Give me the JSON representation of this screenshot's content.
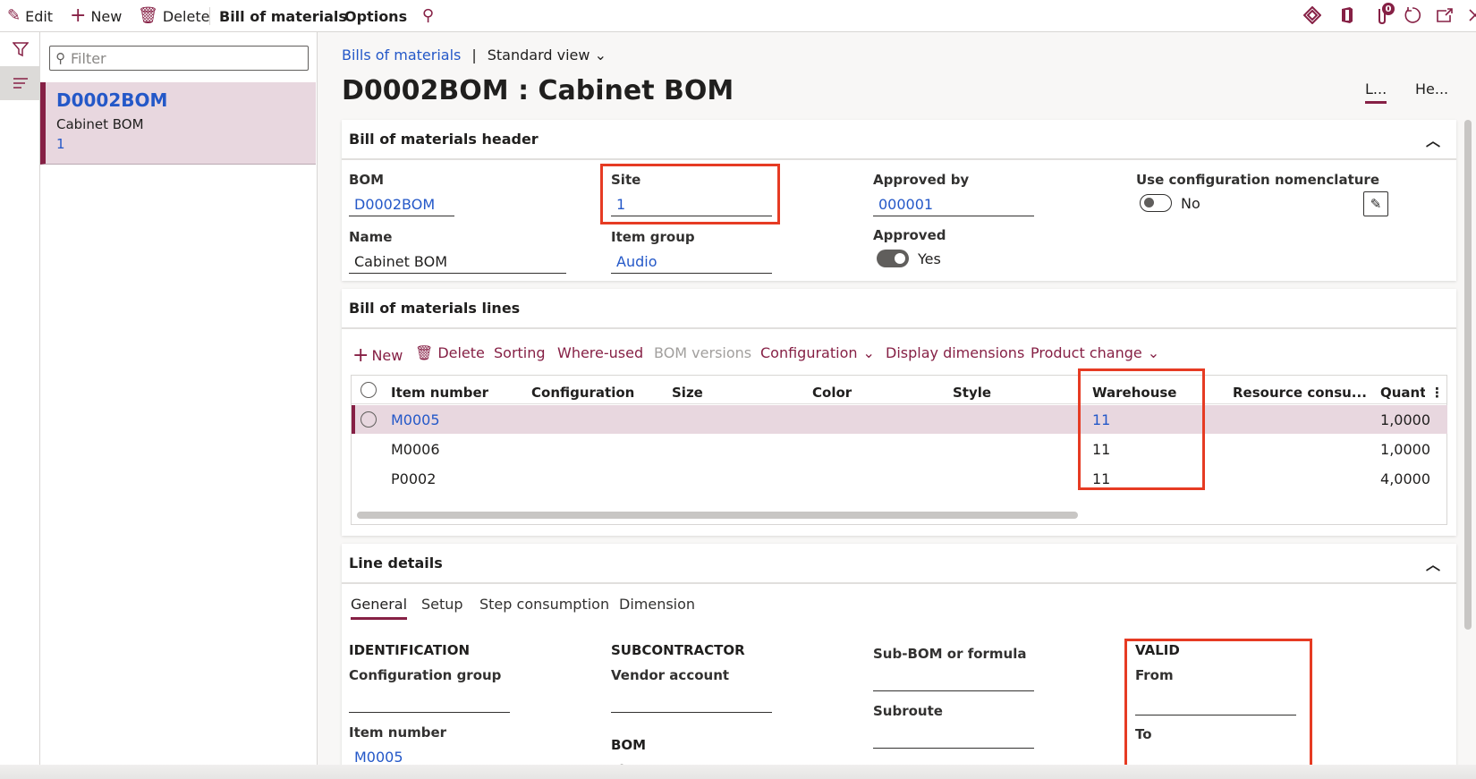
{
  "topbar": {
    "edit": "Edit",
    "new": "New",
    "delete": "Delete",
    "bill_of_materials": "Bill of materials",
    "options": "Options",
    "icons": [
      "search-icon",
      "diamond-grid-icon",
      "office-icon",
      "attachments-icon",
      "refresh-icon",
      "open-in-new-window-icon",
      "close-icon"
    ],
    "attachment_count": "0"
  },
  "colors": {
    "brand": "#862045",
    "link": "#2458c8",
    "highlight": "#e63b23",
    "selected_row": "#e8d7df"
  },
  "listpane": {
    "filter_placeholder": "Filter",
    "items": [
      {
        "id": "D0002BOM",
        "name": "Cabinet BOM",
        "site": "1"
      }
    ]
  },
  "breadcrumb": {
    "link": "Bills of materials",
    "separator": "|",
    "view": "Standard view"
  },
  "page_title": "D0002BOM : Cabinet BOM",
  "view_tabs": [
    {
      "label": "L...",
      "active": true
    },
    {
      "label": "He...",
      "active": false
    }
  ],
  "header_card": {
    "title": "Bill of materials header",
    "fields": {
      "bom": {
        "label": "BOM",
        "value": "D0002BOM"
      },
      "name": {
        "label": "Name",
        "value": "Cabinet BOM"
      },
      "site": {
        "label": "Site",
        "value": "1"
      },
      "item_group": {
        "label": "Item group",
        "value": "Audio"
      },
      "approved_by": {
        "label": "Approved by",
        "value": "000001"
      },
      "approved": {
        "label": "Approved",
        "value": "Yes",
        "on": true
      },
      "use_config_nomenclature": {
        "label": "Use configuration nomenclature",
        "value": "No",
        "on": false
      }
    }
  },
  "lines_card": {
    "title": "Bill of materials lines",
    "toolbar": {
      "new": "New",
      "delete": "Delete",
      "sorting": "Sorting",
      "where_used": "Where-used",
      "bom_versions": "BOM versions",
      "configuration": "Configuration",
      "display_dimensions": "Display dimensions",
      "product_change": "Product change"
    },
    "columns": [
      "Item number",
      "Configuration",
      "Size",
      "Color",
      "Style",
      "Warehouse",
      "Resource consu...",
      "Quantit"
    ],
    "rows": [
      {
        "item_number": "M0005",
        "configuration": "",
        "size": "",
        "color": "",
        "style": "",
        "warehouse": "11",
        "resource_consumption": "",
        "quantity": "1,0000",
        "selected": true
      },
      {
        "item_number": "M0006",
        "configuration": "",
        "size": "",
        "color": "",
        "style": "",
        "warehouse": "11",
        "resource_consumption": "",
        "quantity": "1,0000",
        "selected": false
      },
      {
        "item_number": "P0002",
        "configuration": "",
        "size": "",
        "color": "",
        "style": "",
        "warehouse": "11",
        "resource_consumption": "",
        "quantity": "4,0000",
        "selected": false
      }
    ]
  },
  "details_card": {
    "title": "Line details",
    "tabs": [
      {
        "label": "General",
        "active": true
      },
      {
        "label": "Setup"
      },
      {
        "label": "Step consumption"
      },
      {
        "label": "Dimension"
      }
    ],
    "identification": {
      "heading": "IDENTIFICATION",
      "config_group_label": "Configuration group",
      "config_group_value": "",
      "item_number_label": "Item number",
      "item_number_value": "M0005"
    },
    "subcontractor": {
      "heading": "SUBCONTRACTOR",
      "vendor_account_label": "Vendor account",
      "vendor_account_value": ""
    },
    "bom": {
      "heading": "BOM",
      "line_type_label": "Line type"
    },
    "sub_bom": {
      "label": "Sub-BOM or formula",
      "value": ""
    },
    "subroute": {
      "label": "Subroute",
      "value": ""
    },
    "valid": {
      "heading": "VALID",
      "from_label": "From",
      "from_value": "",
      "to_label": "To"
    }
  }
}
